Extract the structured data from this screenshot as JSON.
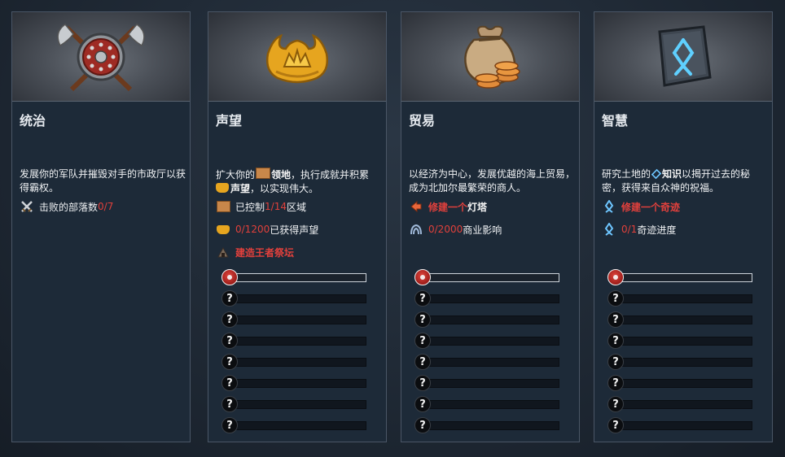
{
  "cards": [
    {
      "title": "统治",
      "desc_text": "发展你的军队并摧毁对手的市政厅以获得霸权。",
      "req1_label": "击败的部落数",
      "req1_value": "0/7"
    },
    {
      "title": "声望",
      "desc_a": "扩大你的",
      "desc_hl1": "领地",
      "desc_b": "，执行成就并积累",
      "desc_hl2": "声望",
      "desc_c": "，以实现伟大。",
      "req1_prefix": "已控制",
      "req1_value": "1/14",
      "req1_suffix": "区域",
      "req2_value": "0/1200",
      "req2_label": "已获得声望",
      "req3_label": "建造王者祭坛",
      "stages": [
        "?",
        "?",
        "?",
        "?",
        "?",
        "?",
        "?"
      ]
    },
    {
      "title": "贸易",
      "desc_text": "以经济为中心，发展优越的海上贸易，成为北加尔最繁荣的商人。",
      "req1_prefix": "修建一个",
      "req1_label": "灯塔",
      "req2_value": "0/2000",
      "req2_label": "商业影响",
      "stages": [
        "?",
        "?",
        "?",
        "?",
        "?",
        "?",
        "?"
      ]
    },
    {
      "title": "智慧",
      "desc_a": "研究土地的",
      "desc_hl1": "知识",
      "desc_b": "以揭开过去的秘密，获得来自众神的祝福。",
      "req1_label": "修建一个奇迹",
      "req2_value": "0/1",
      "req2_label": "奇迹进度",
      "stages": [
        "?",
        "?",
        "?",
        "?",
        "?",
        "?",
        "?"
      ]
    }
  ],
  "colors": {
    "accent_red": "#e0403b",
    "panel_bg": "#1d2a38",
    "knowledge_blue": "#6ec6ff"
  },
  "icons": [
    "domination-shield-icon",
    "fame-crown-icon",
    "trade-money-bag-icon",
    "lore-rune-stone-icon"
  ]
}
